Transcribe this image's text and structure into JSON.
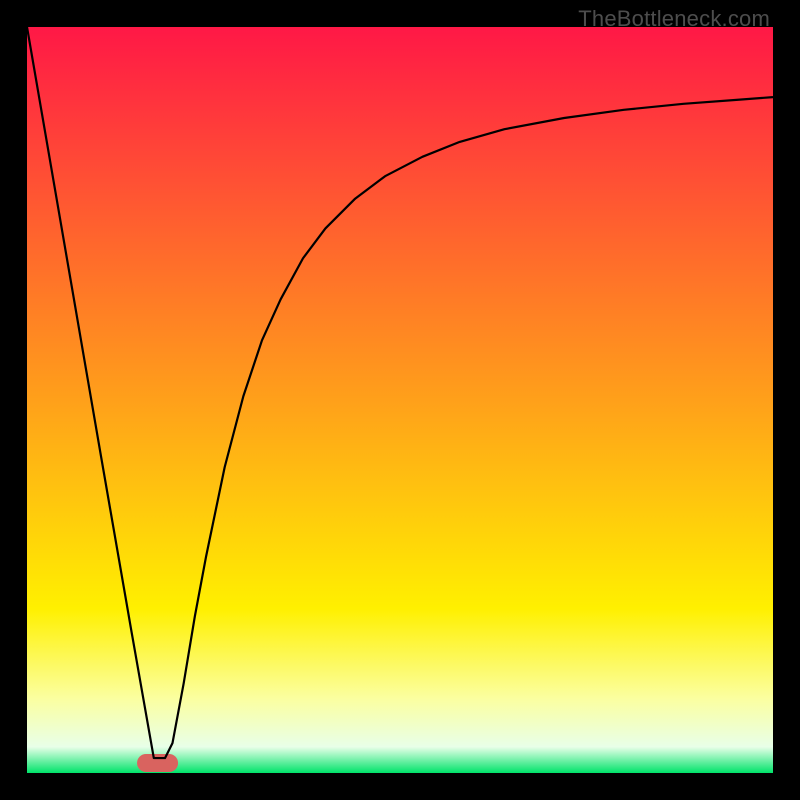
{
  "watermark": "TheBottleneck.com",
  "chart_data": {
    "type": "line",
    "title": "",
    "xlabel": "",
    "ylabel": "",
    "xlim": [
      0,
      100
    ],
    "ylim": [
      0,
      100
    ],
    "grid": false,
    "legend": false,
    "background_gradient_stops": [
      {
        "offset": 0.0,
        "color": "#ff1846"
      },
      {
        "offset": 0.5,
        "color": "#ffa01a"
      },
      {
        "offset": 0.78,
        "color": "#fff000"
      },
      {
        "offset": 0.9,
        "color": "#fbffa0"
      },
      {
        "offset": 0.965,
        "color": "#e8ffe8"
      },
      {
        "offset": 1.0,
        "color": "#00e36a"
      }
    ],
    "series": [
      {
        "name": "bottleneck-curve",
        "x": [
          0.0,
          2,
          4,
          6,
          8,
          10,
          12,
          14,
          15.5,
          17.0,
          18.5,
          19.5,
          21,
          22.5,
          24.0,
          26.5,
          29.0,
          31.5,
          34.0,
          37.0,
          40.0,
          44.0,
          48.0,
          53.0,
          58.0,
          64.0,
          72.0,
          80.0,
          88.0,
          96.0,
          100.0
        ],
        "y": [
          100.0,
          88.4,
          76.8,
          65.2,
          53.6,
          42.0,
          30.5,
          19.0,
          10.5,
          2.0,
          2.0,
          4.0,
          12.0,
          21.0,
          29.0,
          41.0,
          50.5,
          58.0,
          63.5,
          69.0,
          73.0,
          77.0,
          80.0,
          82.6,
          84.6,
          86.3,
          87.8,
          88.9,
          89.7,
          90.3,
          90.6
        ]
      }
    ],
    "marker": {
      "name": "target-marker",
      "x": 17.5,
      "width": 5.5,
      "color": "#d9635f"
    }
  }
}
